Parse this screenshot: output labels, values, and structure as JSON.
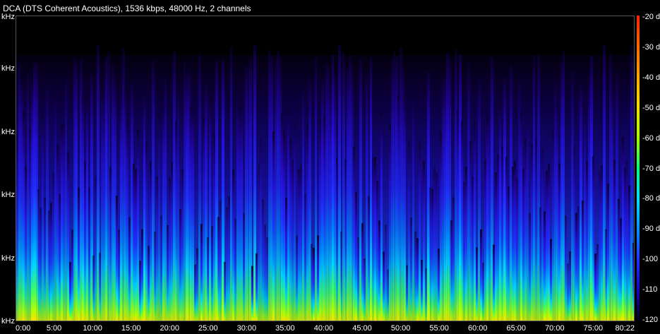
{
  "title": "DCA (DTS Coherent Acoustics), 1536 kbps, 48000 Hz, 2 channels",
  "chart_data": {
    "type": "heatmap",
    "title": "DCA (DTS Coherent Acoustics), 1536 kbps, 48000 Hz, 2 channels",
    "x_ticks": [
      "0:00",
      "5:00",
      "10:00",
      "15:00",
      "20:00",
      "25:00",
      "30:00",
      "35:00",
      "40:00",
      "45:00",
      "50:00",
      "55:00",
      "60:00",
      "65:00",
      "70:00",
      "75:00",
      "80:22"
    ],
    "x_range_minutes": [
      0,
      80.37
    ],
    "y_ticks": [
      "kHz",
      "kHz",
      "kHz",
      "kHz",
      "kHz",
      "kHz"
    ],
    "colorbar_ticks": [
      "-20 d",
      "-30 d",
      "-40 d",
      "-50 d",
      "-60 d",
      "-70 d",
      "-80 d",
      "-90 d",
      "-100",
      "-110",
      "-120"
    ],
    "colorbar_range_db": [
      -120,
      -20
    ],
    "colormap": [
      "#000010",
      "#1a00c0",
      "#2030ff",
      "#0090ff",
      "#00e0ff",
      "#00ff80",
      "#a8ff00",
      "#ffd800",
      "#ff8000",
      "#ff2000"
    ]
  }
}
